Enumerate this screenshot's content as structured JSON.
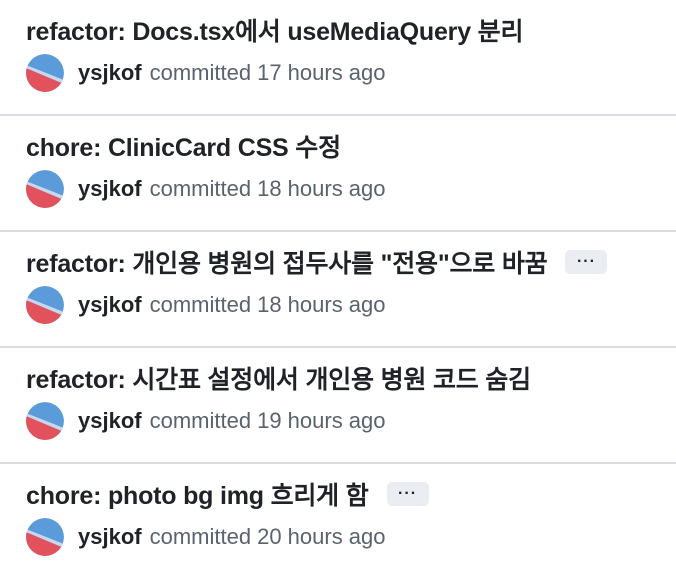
{
  "commits": [
    {
      "title": "refactor: Docs.tsx에서 useMediaQuery 분리",
      "author": "ysjkof",
      "action": "committed",
      "time": "17 hours ago",
      "has_more_button": false
    },
    {
      "title": "chore: ClinicCard CSS 수정",
      "author": "ysjkof",
      "action": "committed",
      "time": "18 hours ago",
      "has_more_button": false
    },
    {
      "title": "refactor: 개인용 병원의 접두사를 \"전용\"으로 바꿈",
      "author": "ysjkof",
      "action": "committed",
      "time": "18 hours ago",
      "has_more_button": true,
      "more_label": "···"
    },
    {
      "title": "refactor: 시간표 설정에서 개인용 병원 코드 숨김",
      "author": "ysjkof",
      "action": "committed",
      "time": "19 hours ago",
      "has_more_button": false
    },
    {
      "title": "chore: photo bg img 흐리게 함",
      "author": "ysjkof",
      "action": "committed",
      "time": "20 hours ago",
      "has_more_button": true,
      "more_label": "···"
    }
  ],
  "avatar_colors": {
    "top": "#5b9bd9",
    "bottom": "#e2525c",
    "stripe": "#c7d7ee"
  }
}
